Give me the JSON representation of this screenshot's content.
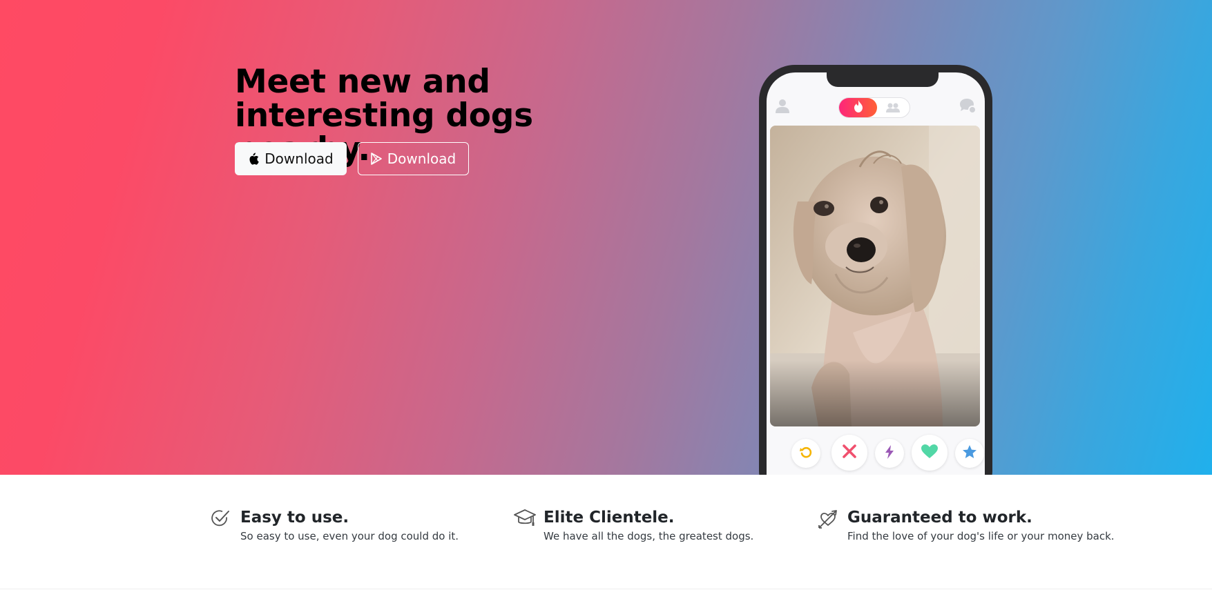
{
  "hero": {
    "headline": "Meet new and interesting dogs nearby.",
    "buttons": [
      {
        "label": "Download",
        "icon": "apple-icon",
        "style": "light"
      },
      {
        "label": "Download",
        "icon": "google-play-icon",
        "style": "outline"
      }
    ],
    "gradient": {
      "start": "#ff4a63",
      "end": "#20b0ec"
    }
  },
  "phone": {
    "header_icons": [
      "profile-icon",
      "flame-icon",
      "group-icon",
      "chat-icon"
    ],
    "card_image": "photo of a small wet tan dog",
    "actions": [
      {
        "name": "rewind-button",
        "icon": "rewind-icon",
        "color": "#f5b400"
      },
      {
        "name": "nope-button",
        "icon": "x-icon",
        "color": "#f0506e"
      },
      {
        "name": "boost-button",
        "icon": "bolt-icon",
        "color": "#9b59b6"
      },
      {
        "name": "like-button",
        "icon": "heart-icon",
        "color": "#52d7a6"
      },
      {
        "name": "superlike-button",
        "icon": "star-icon",
        "color": "#4a9ae0"
      }
    ]
  },
  "features": [
    {
      "title": "Easy to use.",
      "text": "So easy to use, even your dog could do it.",
      "icon": "check-circle-icon"
    },
    {
      "title": "Elite Clientele.",
      "text": "We have all the dogs, the greatest dogs.",
      "icon": "graduation-cap-icon"
    },
    {
      "title": "Guaranteed to work.",
      "text": "Find the love of your dog's life or your money back.",
      "icon": "heart-arrow-icon"
    }
  ]
}
